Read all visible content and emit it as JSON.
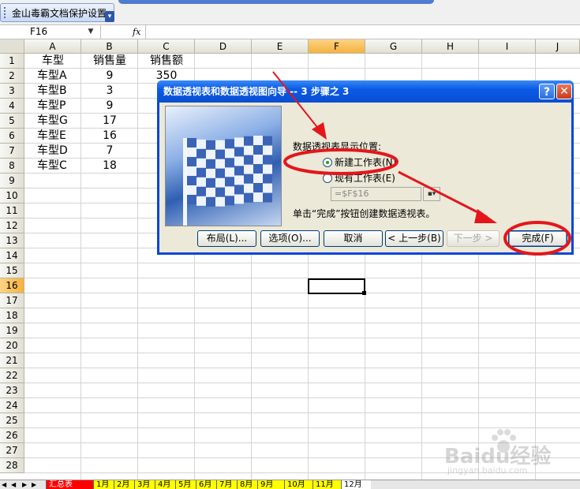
{
  "toolbar": {
    "plugin_label": "金山毒霸文档保护设置"
  },
  "formula_bar": {
    "name_box": "F16",
    "fx_label": "fx",
    "formula": ""
  },
  "columns": [
    "A",
    "B",
    "C",
    "D",
    "E",
    "F",
    "G",
    "H",
    "I",
    "J"
  ],
  "rows": [
    "1",
    "2",
    "3",
    "4",
    "5",
    "6",
    "7",
    "8",
    "9",
    "10",
    "11",
    "12",
    "13",
    "14",
    "15",
    "16",
    "17",
    "18",
    "19",
    "20",
    "21",
    "22",
    "23",
    "24",
    "25",
    "26",
    "27",
    "28"
  ],
  "active_cell": {
    "column": "F",
    "row": "16"
  },
  "table": {
    "headers": [
      "车型",
      "销售量",
      "销售额"
    ],
    "rows": [
      [
        "车型A",
        "9",
        "350"
      ],
      [
        "车型B",
        "3",
        ""
      ],
      [
        "车型P",
        "9",
        ""
      ],
      [
        "车型G",
        "17",
        ""
      ],
      [
        "车型E",
        "16",
        ""
      ],
      [
        "车型D",
        "7",
        ""
      ],
      [
        "车型C",
        "18",
        ""
      ]
    ]
  },
  "dialog": {
    "title": "数据透视表和数据透视图向导 -- 3 步骤之 3",
    "help_label": "?",
    "close_label": "✕",
    "location_prompt": "数据透视表显示位置:",
    "options": [
      {
        "label": "新建工作表(N)",
        "selected": true
      },
      {
        "label": "现有工作表(E)",
        "selected": false
      }
    ],
    "reference_value": "=$F$16",
    "hint": "单击“完成”按钮创建数据透视表。",
    "buttons": {
      "layout": "布局(L)...",
      "options": "选项(O)...",
      "cancel": "取消",
      "back": "< 上一步(B)",
      "next": "下一步 >",
      "finish": "完成(F)"
    }
  },
  "sheet_tabs": [
    "汇总表",
    "1月",
    "2月",
    "3月",
    "4月",
    "5月",
    "6月",
    "7月",
    "8月",
    "9月",
    "10月",
    "11月",
    "12月"
  ],
  "watermark": {
    "text": "Baidu经验",
    "sub": "jingyan.baidu.com"
  },
  "colors": {
    "dialog_title": "#0a5ae6",
    "active_header": "#f7b23c",
    "annotation": "#e4161c",
    "summary_tab": "#ff0000",
    "month_tab": "#ffff00"
  }
}
